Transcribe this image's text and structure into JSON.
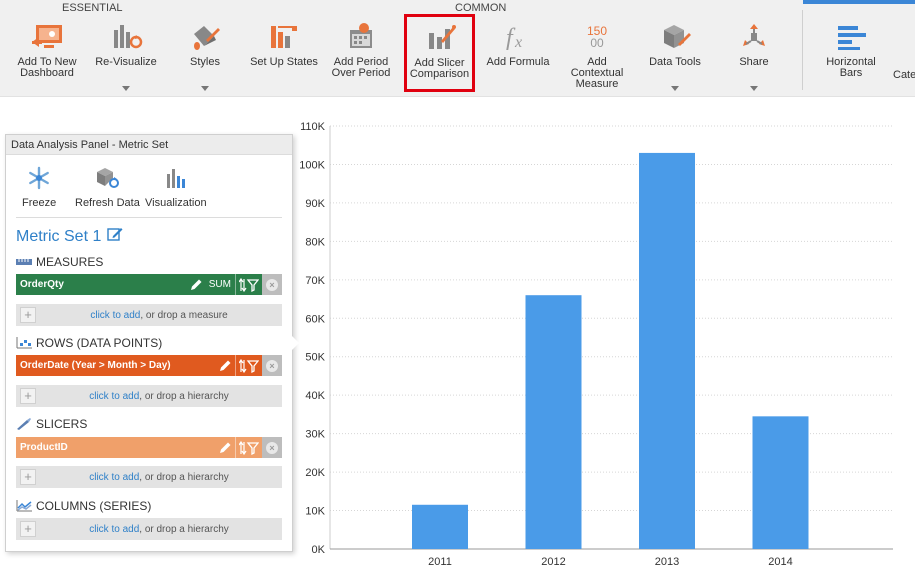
{
  "ribbon": {
    "groups": {
      "essential": "ESSENTIAL",
      "common": "COMMON"
    },
    "buttons": {
      "add_to_dashboard": {
        "line1": "Add To New",
        "line2": "Dashboard"
      },
      "revisualize": "Re-Visualize",
      "styles": "Styles",
      "setup_states": "Set Up States",
      "add_period": {
        "line1": "Add Period",
        "line2": "Over Period"
      },
      "slicer_comparison": {
        "line1": "Add Slicer",
        "line2": "Comparison"
      },
      "add_formula": "Add Formula",
      "add_contextual": {
        "line1": "Add",
        "line2": "Contextual",
        "line3": "Measure",
        "icon_top": "150",
        "icon_bottom": "00"
      },
      "data_tools": "Data Tools",
      "share": "Share",
      "horizontal_bars": {
        "line1": "Horizontal",
        "line2": "Bars"
      },
      "category_partial": "Cate"
    },
    "highlight_color": "#e0000f"
  },
  "panel": {
    "title": "Data Analysis Panel - Metric Set",
    "tools": {
      "freeze": "Freeze",
      "refresh": "Refresh Data",
      "visualization": "Visualization"
    },
    "metric_set_title": "Metric Set 1",
    "sections": {
      "measures": {
        "header": "MEASURES",
        "field": {
          "name": "OrderQty",
          "aggregation": "SUM",
          "color": "#2b7f4a"
        },
        "drop": {
          "link": "click to add",
          "rest": ", or drop a measure"
        }
      },
      "rows": {
        "header": "ROWS (DATA POINTS)",
        "field": {
          "name": "OrderDate (Year > Month > Day)",
          "color": "#e05a1f"
        },
        "drop": {
          "link": "click to add",
          "rest": ", or drop a hierarchy"
        }
      },
      "slicers": {
        "header": "SLICERS",
        "field": {
          "name": "ProductID",
          "color": "#f0a06a"
        },
        "drop": {
          "link": "click to add",
          "rest": ", or drop a hierarchy"
        }
      },
      "columns": {
        "header": "COLUMNS (SERIES)",
        "drop": {
          "link": "click to add",
          "rest": ", or drop a hierarchy"
        }
      }
    }
  },
  "chart_data": {
    "type": "bar",
    "categories": [
      "2011",
      "2012",
      "2013",
      "2014"
    ],
    "values": [
      11500,
      66000,
      103000,
      34500
    ],
    "ylim": [
      0,
      110000
    ],
    "yticks": [
      "0K",
      "10K",
      "20K",
      "30K",
      "40K",
      "50K",
      "60K",
      "70K",
      "80K",
      "90K",
      "100K",
      "110K"
    ],
    "grid": true,
    "bar_color": "#4a9be8",
    "title": "",
    "xlabel": "",
    "ylabel": ""
  }
}
